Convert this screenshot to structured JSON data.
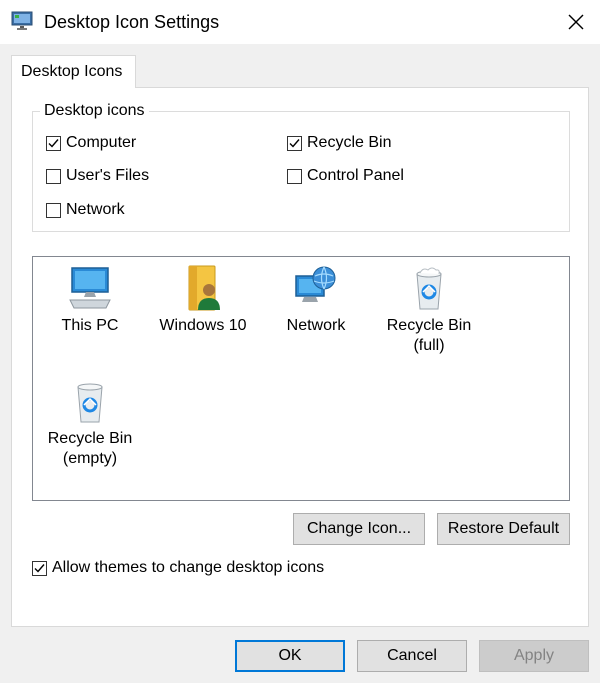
{
  "window": {
    "title": "Desktop Icon Settings"
  },
  "tabs": [
    {
      "label": "Desktop Icons",
      "selected": true
    }
  ],
  "desktop_icons_group": {
    "legend": "Desktop icons",
    "checkboxes": [
      {
        "label": "Computer",
        "checked": true
      },
      {
        "label": "Recycle Bin",
        "checked": true
      },
      {
        "label": "User's Files",
        "checked": false
      },
      {
        "label": "Control Panel",
        "checked": false
      },
      {
        "label": "Network",
        "checked": false
      }
    ]
  },
  "icon_list": [
    {
      "label": "This PC",
      "icon": "this-pc-icon"
    },
    {
      "label": "Windows 10",
      "icon": "user-files-icon"
    },
    {
      "label": "Network",
      "icon": "network-icon"
    },
    {
      "label": "Recycle Bin\n(full)",
      "label_line1": "Recycle Bin",
      "label_line2": "(full)",
      "icon": "recycle-bin-full-icon"
    },
    {
      "label_line1": "Recycle Bin",
      "label_line2": "(empty)",
      "icon": "recycle-bin-empty-icon"
    }
  ],
  "buttons": {
    "change_icon": "Change Icon...",
    "restore_default": "Restore Default",
    "ok": "OK",
    "cancel": "Cancel",
    "apply": "Apply"
  },
  "allow_themes": {
    "label": "Allow themes to change desktop icons",
    "checked": true
  },
  "colors": {
    "accent": "#0078d7",
    "dialog_bg": "#f0f0f0",
    "disabled_text": "#838383"
  }
}
